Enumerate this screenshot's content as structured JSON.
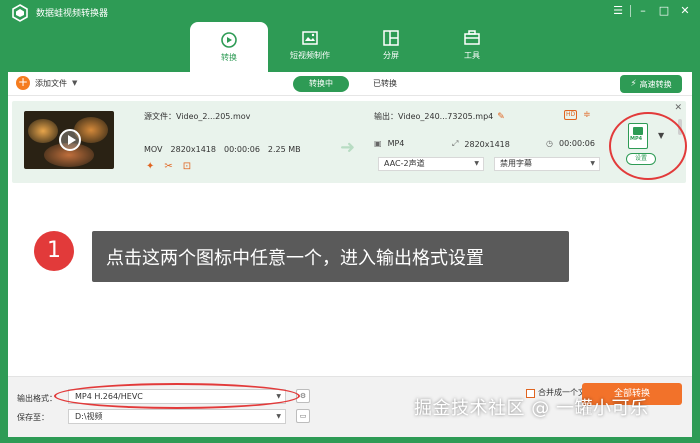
{
  "app": {
    "title": "数据蛙视频转换器"
  },
  "window_controls": [
    "☰",
    "–",
    "□",
    "✕"
  ],
  "nav": {
    "tabs": [
      {
        "label": "转换",
        "icon": "convert-icon",
        "active": true
      },
      {
        "label": "短视频制作",
        "icon": "video-make-icon",
        "active": false
      },
      {
        "label": "分屏",
        "icon": "split-screen-icon",
        "active": false
      },
      {
        "label": "工具",
        "icon": "toolbox-icon",
        "active": false
      }
    ]
  },
  "toolbar": {
    "add_file": "添加文件",
    "converting": "转换中",
    "converted": "已转换",
    "fast_convert": "高速转换"
  },
  "file": {
    "source_name": "源文件：Video_2...205.mov",
    "format": "MOV",
    "resolution": "2820x1418",
    "duration": "00:00:06",
    "size": "2.25 MB",
    "output_name": "输出：Video_240...73205.mp4",
    "out_format": "MP4",
    "out_resolution": "2820x1418",
    "out_duration": "00:00:06",
    "audio": "AAC-2声道",
    "subtitle": "禁用字幕",
    "format_icon_label": "MP4",
    "settings_label": "设置"
  },
  "callout": {
    "step": "1",
    "text": "点击这两个图标中任意一个，进入输出格式设置"
  },
  "bottom": {
    "output_format_label": "输出格式：",
    "output_format_value": "MP4 H.264/HEVC",
    "save_to_label": "保存至：",
    "save_to_value": "D:\\视频",
    "merge_label": "合并成一个文件",
    "convert_all": "全部转换"
  },
  "watermark": "掘金技术社区 @ 一罐小可乐",
  "colors": {
    "brand_green": "#2e9b55",
    "accent_orange": "#f2722a",
    "annotation_red": "#e23a3a"
  }
}
